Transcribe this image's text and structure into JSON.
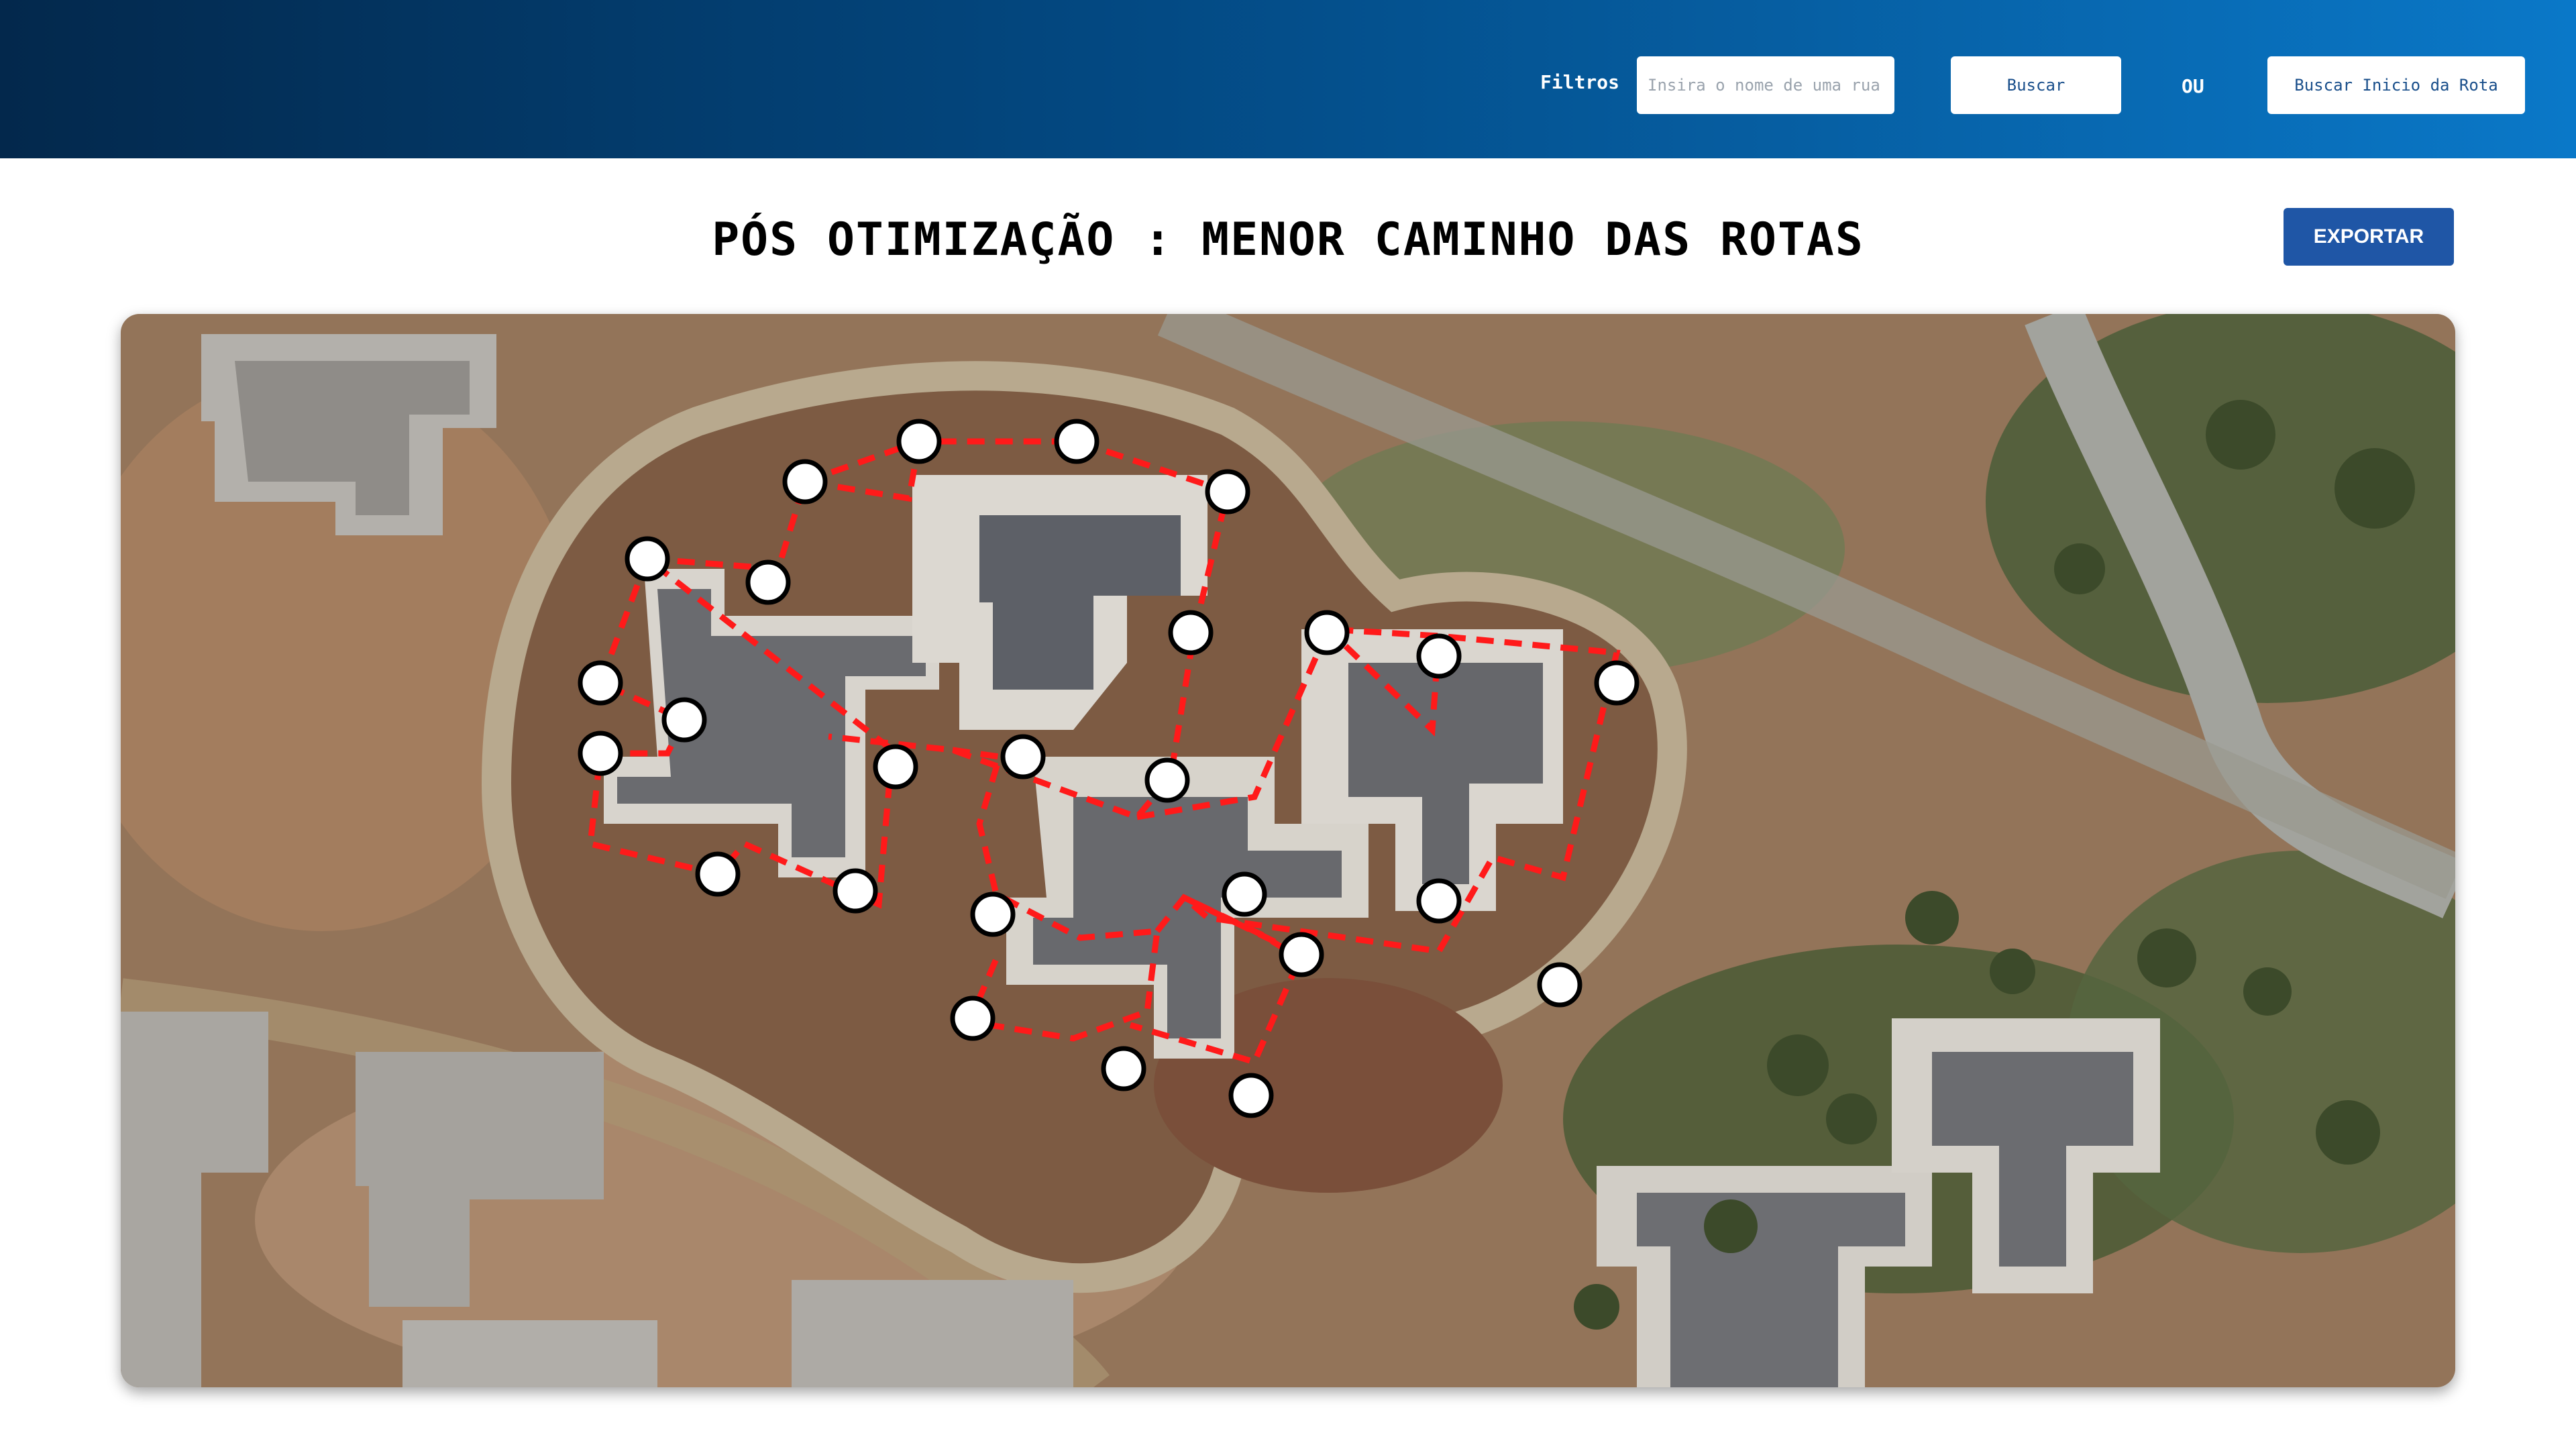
{
  "header": {
    "filters_label": "Filtros",
    "search_placeholder": "Insira o nome de uma rua",
    "search_value": "",
    "search_button": "Buscar",
    "or_label": "OU",
    "route_start_button": "Buscar Inicio da Rota"
  },
  "main": {
    "title": "PÓS OTIMIZAÇÃO : MENOR CAMINHO DAS ROTAS",
    "export_button": "EXPORTAR"
  },
  "map": {
    "route_color": "#ff1a1a",
    "marker_fill": "#ffffff",
    "marker_stroke": "#000000"
  },
  "colors": {
    "header_gradient_start": "#03284c",
    "header_gradient_end": "#0a78c8",
    "export_button_bg": "#1f56a6"
  }
}
